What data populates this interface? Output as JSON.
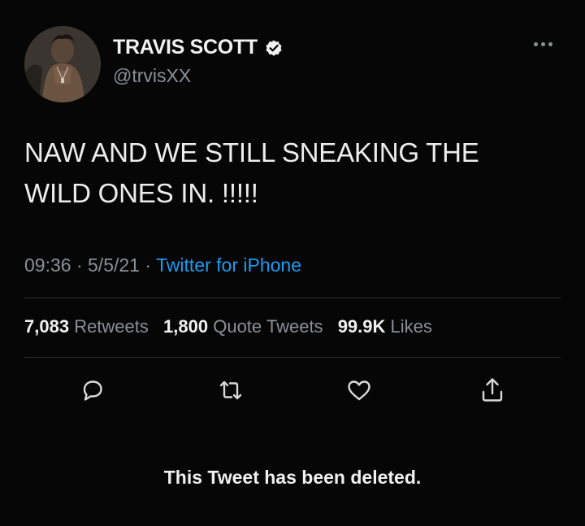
{
  "tweet": {
    "display_name": "TRAVIS SCOTT",
    "handle": "@trvisXX",
    "text_line1": "NAW AND WE STILL SNEAKING THE",
    "text_line2": "WILD ONES IN. !!!!!",
    "time": "09:36",
    "date": "5/5/21",
    "separator": "·",
    "source": "Twitter for iPhone",
    "stats": {
      "retweets_count": "7,083",
      "retweets_label": "Retweets",
      "quotes_count": "1,800",
      "quotes_label": "Quote Tweets",
      "likes_count": "99.9K",
      "likes_label": "Likes"
    },
    "deleted_notice": "This Tweet has been deleted."
  },
  "icons": {
    "verified": "verified-badge-icon",
    "more": "more-options-icon",
    "reply": "reply-icon",
    "retweet": "retweet-icon",
    "like": "like-icon",
    "share": "share-icon"
  },
  "colors": {
    "background": "#060606",
    "text": "#ececec",
    "muted": "#8b9096",
    "link": "#1d9bf0"
  }
}
